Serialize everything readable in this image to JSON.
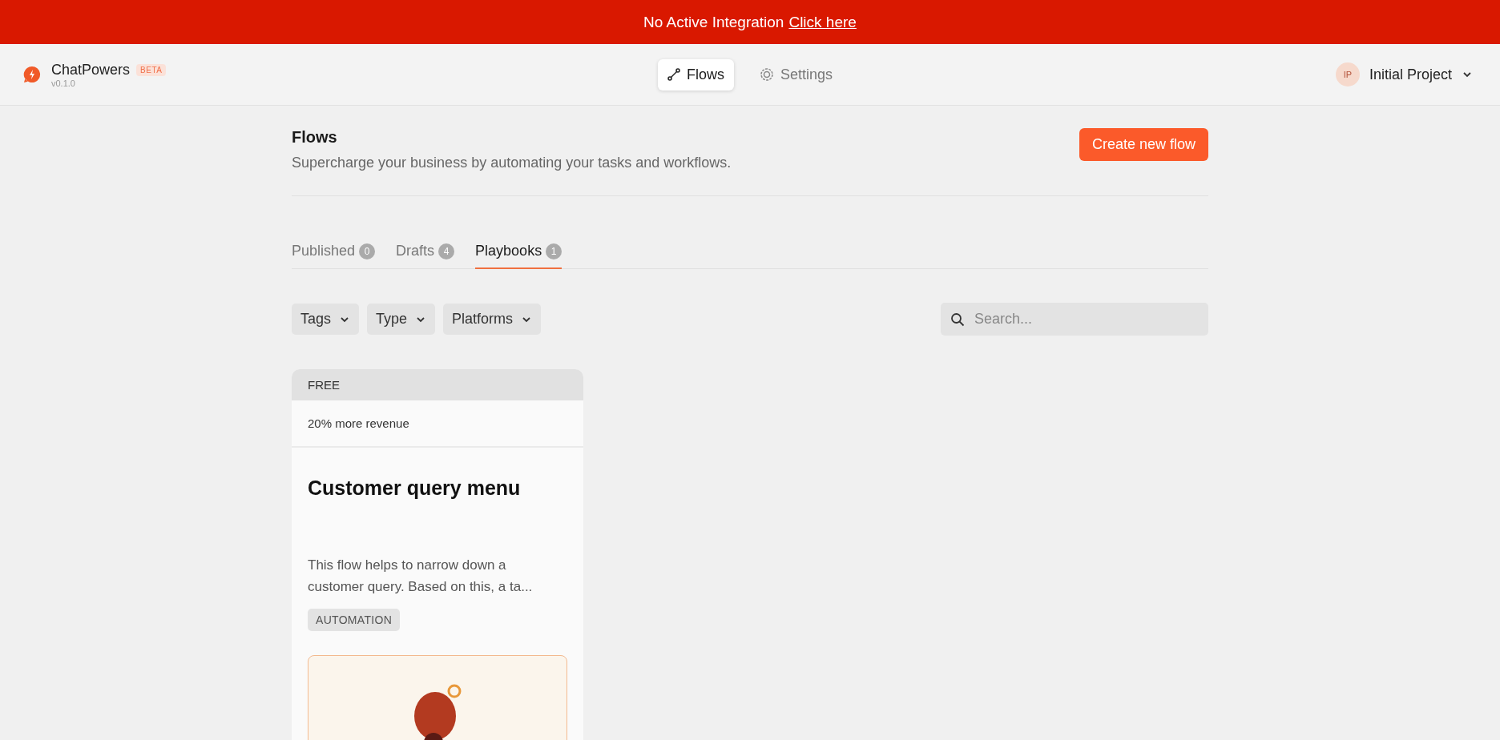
{
  "banner": {
    "message": "No Active Integration",
    "link": "Click here"
  },
  "header": {
    "brand": "ChatPowers",
    "badge": "BETA",
    "version": "v0.1.0",
    "nav": [
      {
        "label": "Flows",
        "kind": "flows",
        "selected": true
      },
      {
        "label": "Settings",
        "kind": "settings",
        "selected": false
      }
    ],
    "project": {
      "initials": "IP",
      "name": "Initial Project"
    }
  },
  "page": {
    "title": "Flows",
    "subtitle": "Supercharge your business by automating your tasks and workflows.",
    "create_button": "Create new flow"
  },
  "tabs": [
    {
      "label": "Published",
      "count": "0",
      "selected": false
    },
    {
      "label": "Drafts",
      "count": "4",
      "selected": false
    },
    {
      "label": "Playbooks",
      "count": "1",
      "selected": true
    }
  ],
  "filters": [
    "Tags",
    "Type",
    "Platforms"
  ],
  "search": {
    "placeholder": "Search..."
  },
  "cards": [
    {
      "plan": "FREE",
      "benefit": "20% more revenue",
      "title": "Customer query menu",
      "description": "This flow helps to narrow down a customer query. Based on this, a ta...",
      "tag": "AUTOMATION"
    }
  ]
}
